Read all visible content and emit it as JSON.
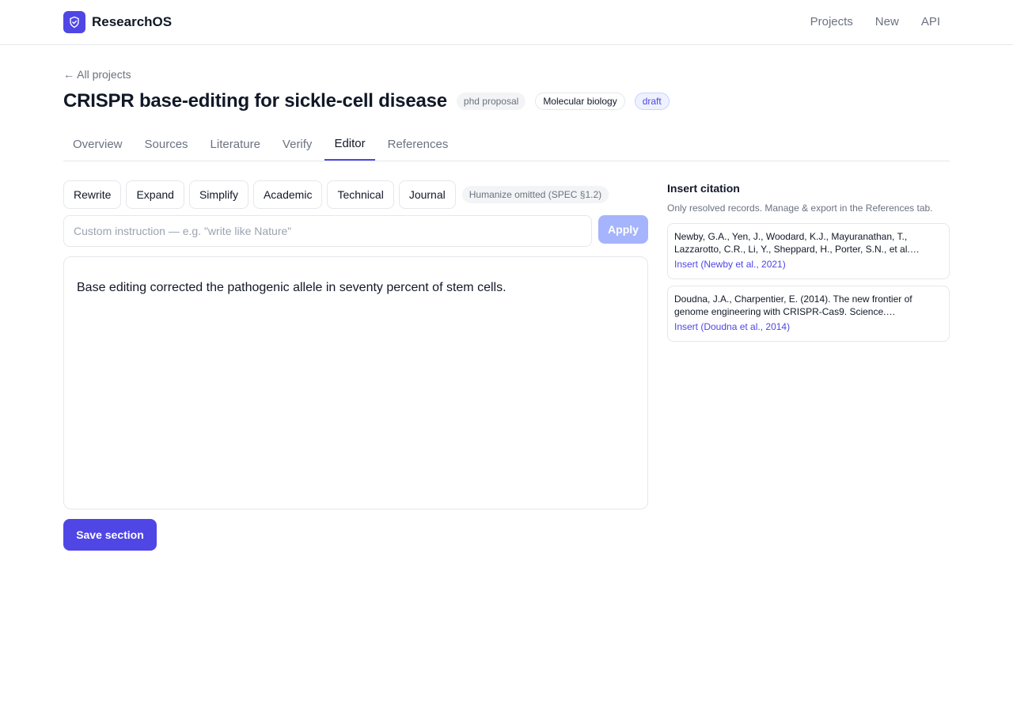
{
  "brand": {
    "name": "ResearchOS",
    "logo_icon": "shield-check-icon",
    "color": "#4f46e5"
  },
  "topnav": [
    "Projects",
    "New",
    "API"
  ],
  "back_link": "← All projects",
  "project": {
    "title": "CRISPR base-editing for sickle-cell disease",
    "badges": [
      "phd proposal",
      "Molecular biology",
      "draft"
    ]
  },
  "tabs": [
    {
      "label": "Overview",
      "active": false
    },
    {
      "label": "Sources",
      "active": false
    },
    {
      "label": "Literature",
      "active": false
    },
    {
      "label": "Verify",
      "active": false
    },
    {
      "label": "Editor",
      "active": true
    },
    {
      "label": "References",
      "active": false
    }
  ],
  "tools": [
    "Rewrite",
    "Expand",
    "Simplify",
    "Academic",
    "Technical",
    "Journal"
  ],
  "humanize_note": "Humanize omitted (SPEC §1.2)",
  "instruction": {
    "value": "",
    "placeholder": "Custom instruction — e.g. \"write like Nature\"",
    "apply_label": "Apply"
  },
  "editor": {
    "text": "Base editing corrected the pathogenic allele in seventy percent of stem cells."
  },
  "save_label": "Save section",
  "citations": {
    "title": "Insert citation",
    "subtitle": "Only resolved records. Manage & export in the References tab.",
    "items": [
      {
        "text": "Newby, G.A., Yen, J., Woodard, K.J., Mayuranathan, T., Lazzarotto, C.R., Li, Y., Sheppard, H., Porter, S.N., et al.…",
        "insert_label": "Insert (Newby et al., 2021)"
      },
      {
        "text": "Doudna, J.A., Charpentier, E. (2014). The new frontier of genome engineering with CRISPR-Cas9. Science.…",
        "insert_label": "Insert (Doudna et al., 2014)"
      }
    ]
  },
  "colors": {
    "accent": "#4f46e5",
    "accent_light": "#a5b4fc",
    "border": "#e5e7eb",
    "muted_text": "#6b7280"
  }
}
